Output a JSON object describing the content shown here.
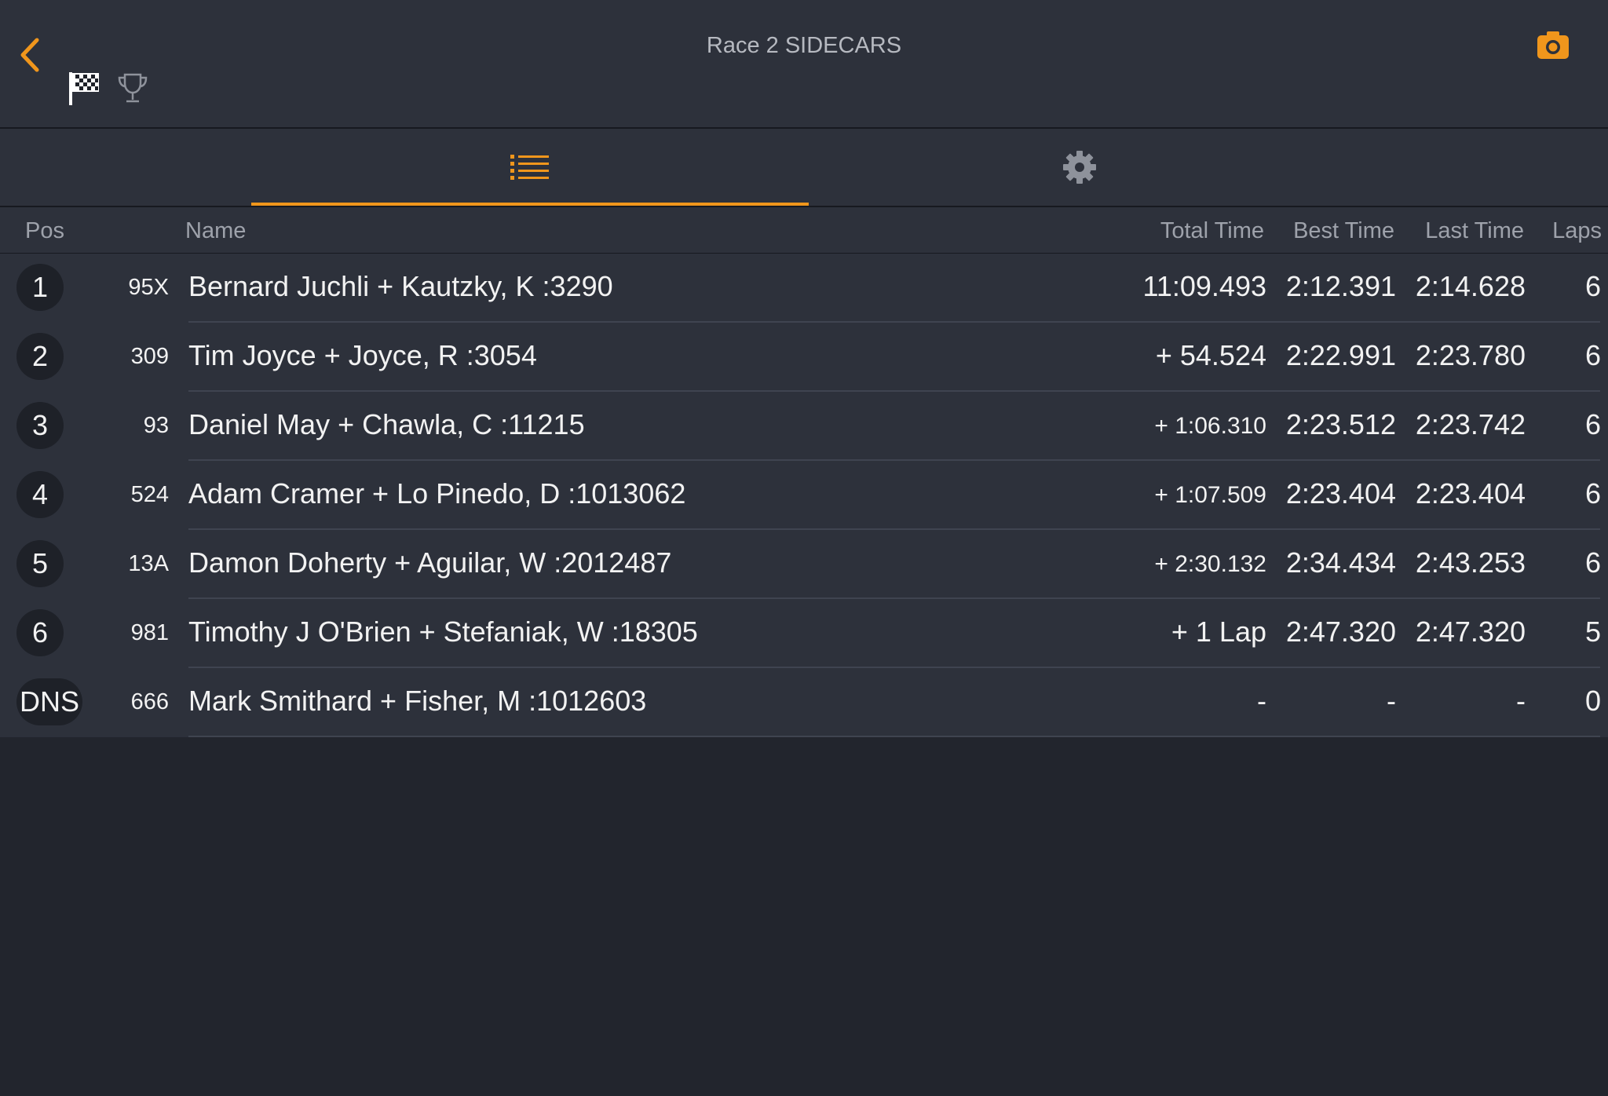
{
  "header": {
    "title": "Race 2 SIDECARS",
    "accent_color": "#f0961c"
  },
  "icons": {
    "back": "chevron-left-icon",
    "flag": "checkered-flag-icon",
    "trophy": "trophy-icon",
    "camera": "camera-icon",
    "list": "list-icon",
    "settings": "gear-icon"
  },
  "tabs": [
    {
      "name": "list",
      "active": true
    },
    {
      "name": "settings",
      "active": false
    }
  ],
  "table": {
    "headers": {
      "pos": "Pos",
      "name": "Name",
      "total": "Total Time",
      "best": "Best Time",
      "last": "Last Time",
      "laps": "Laps"
    },
    "rows": [
      {
        "pos": "1",
        "num": "95X",
        "name": "Bernard Juchli + Kautzky, K :3290",
        "total": "11:09.493",
        "best": "2:12.391",
        "last": "2:14.628",
        "laps": "6"
      },
      {
        "pos": "2",
        "num": "309",
        "name": "Tim Joyce + Joyce, R :3054",
        "total": "+ 54.524",
        "best": "2:22.991",
        "last": "2:23.780",
        "laps": "6"
      },
      {
        "pos": "3",
        "num": "93",
        "name": "Daniel May + Chawla, C :11215",
        "total": "+ 1:06.310",
        "best": "2:23.512",
        "last": "2:23.742",
        "laps": "6"
      },
      {
        "pos": "4",
        "num": "524",
        "name": "Adam Cramer + Lo Pinedo, D :1013062",
        "total": "+ 1:07.509",
        "best": "2:23.404",
        "last": "2:23.404",
        "laps": "6"
      },
      {
        "pos": "5",
        "num": "13A",
        "name": "Damon Doherty + Aguilar, W :2012487",
        "total": "+ 2:30.132",
        "best": "2:34.434",
        "last": "2:43.253",
        "laps": "6"
      },
      {
        "pos": "6",
        "num": "981",
        "name": "Timothy J O'Brien + Stefaniak, W :18305",
        "total": "+ 1 Lap",
        "best": "2:47.320",
        "last": "2:47.320",
        "laps": "5"
      },
      {
        "pos": "DNS",
        "num": "666",
        "name": "Mark Smithard + Fisher, M :1012603",
        "total": "-",
        "best": "-",
        "last": "-",
        "laps": "0"
      }
    ]
  }
}
